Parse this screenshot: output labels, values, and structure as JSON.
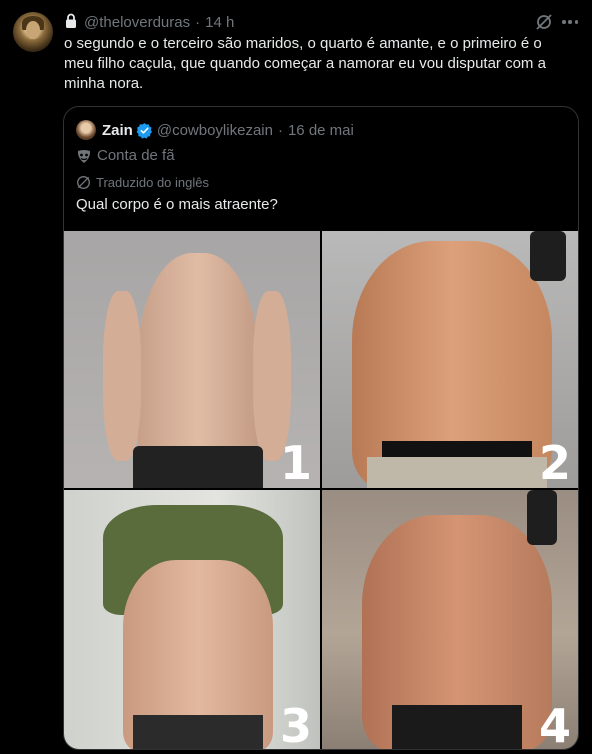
{
  "post": {
    "handle": "@theloverduras",
    "time": "14 h",
    "text": "o segundo e o terceiro são maridos, o quarto é amante, e o primeiro é o meu filho caçula, que quando começar a namorar eu vou disputar com a minha nora."
  },
  "quote": {
    "name": "Zain",
    "handle": "@cowboylikezain",
    "date": "16 de mai",
    "fan_label": "Conta de fã",
    "translated_label": "Traduzido do inglês",
    "text": "Qual corpo é o mais atraente?",
    "photos": [
      {
        "number": "1"
      },
      {
        "number": "2"
      },
      {
        "number": "3"
      },
      {
        "number": "4"
      }
    ]
  },
  "colors": {
    "background": "#000000",
    "text": "#e7e9ea",
    "muted": "#71767b",
    "border": "#2f3336",
    "verified": "#1d9bf0"
  },
  "icons": [
    "lock-icon",
    "grok-icon",
    "more-icon",
    "verified-icon",
    "mask-icon",
    "translate-icon"
  ]
}
